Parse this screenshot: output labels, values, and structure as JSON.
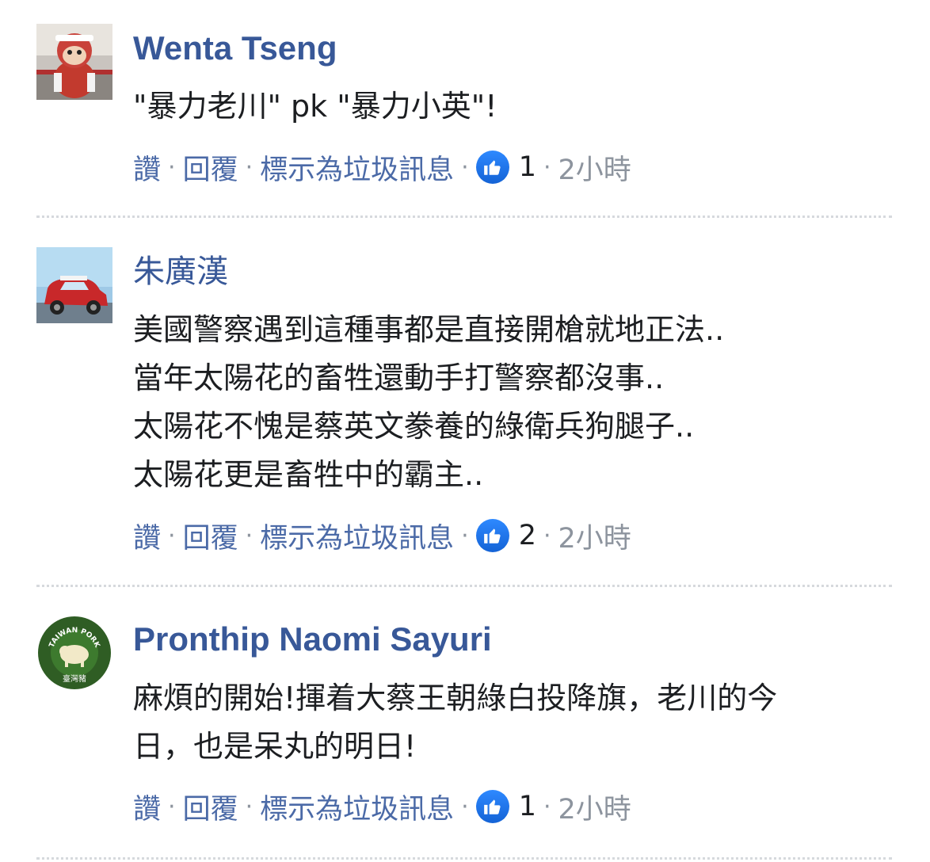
{
  "comments": [
    {
      "author": "Wenta Tseng",
      "lines": [
        "\"暴力老川\" pk \"暴力小英\"!"
      ],
      "actions": {
        "like": "讚",
        "reply": "回覆",
        "spam": "標示為垃圾訊息"
      },
      "like_count": "1",
      "time": "2小時"
    },
    {
      "author": "朱廣漢",
      "lines": [
        "美國警察遇到這種事都是直接開槍就地正法..",
        "當年太陽花的畜牲還動手打警察都沒事..",
        "太陽花不愧是蔡英文豢養的綠衛兵狗腿子..",
        "太陽花更是畜牲中的霸主.."
      ],
      "actions": {
        "like": "讚",
        "reply": "回覆",
        "spam": "標示為垃圾訊息"
      },
      "like_count": "2",
      "time": "2小時"
    },
    {
      "author": "Pronthip Naomi Sayuri",
      "avatar_text": {
        "top": "TAIWAN PORK",
        "bottom": "臺灣豬"
      },
      "lines": [
        "麻煩的開始!揮着大蔡王朝綠白投降旗，老川的今",
        "日，也是呆丸的明日!"
      ],
      "actions": {
        "like": "讚",
        "reply": "回覆",
        "spam": "標示為垃圾訊息"
      },
      "like_count": "1",
      "time": "2小時"
    }
  ],
  "icons": {
    "reaction": "like-thumb-icon"
  },
  "colors": {
    "name": "#385898",
    "link": "#4b6aa7",
    "meta": "#8d949e",
    "like": "#1877f2"
  },
  "separator": "·"
}
